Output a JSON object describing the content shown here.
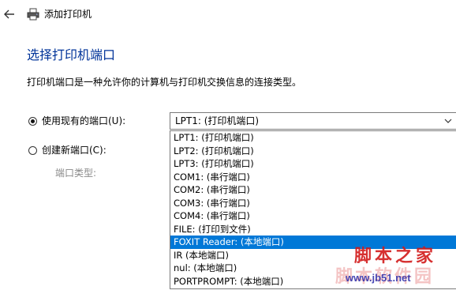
{
  "window": {
    "title": "添加打印机"
  },
  "page": {
    "heading": "选择打印机端口",
    "description": "打印机端口是一种允许你的计算机与打印机交换信息的连接类型。"
  },
  "options": {
    "use_existing": {
      "label": "使用现有的端口(U):",
      "checked": true
    },
    "create_new": {
      "label": "创建新端口(C):",
      "checked": false
    },
    "port_type_label": "端口类型:"
  },
  "port_select": {
    "selected_value": "LPT1: (打印机端口)",
    "options": [
      "LPT1: (打印机端口)",
      "LPT2: (打印机端口)",
      "LPT3: (打印机端口)",
      "COM1: (串行端口)",
      "COM2: (串行端口)",
      "COM3: (串行端口)",
      "COM4: (串行端口)",
      "FILE: (打印到文件)",
      "FOXIT Reader: (本地端口)",
      "IR (本地端口)",
      "nul: (本地端口)",
      "PORTPROMPT: (本地端口)"
    ],
    "highlighted_index": 8
  },
  "watermark": {
    "main": "脚本之家",
    "url": "www.jb51.net",
    "ghost": "脚本软件园"
  },
  "colors": {
    "heading": "#003399",
    "highlight": "#0078d7",
    "disabled_text": "#8a8a8a",
    "watermark_red": "#d21a1a",
    "watermark_blue": "#2a2aa8"
  },
  "icons": {
    "back": "back-arrow-icon",
    "printer": "printer-icon",
    "dropdown": "chevron-down-icon"
  }
}
